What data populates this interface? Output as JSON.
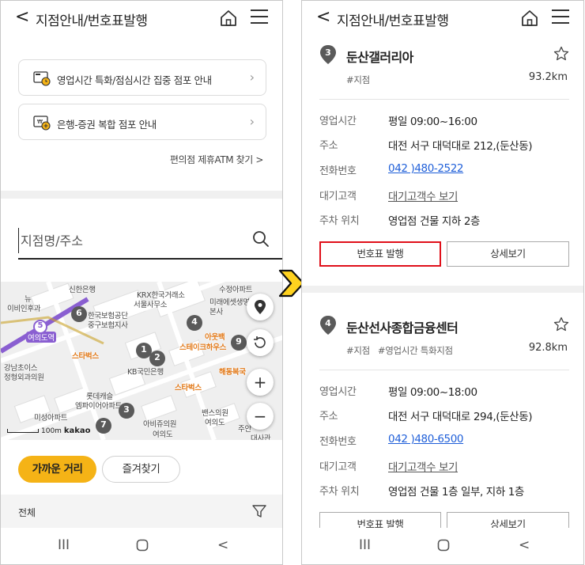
{
  "left": {
    "header": {
      "back_label": "<",
      "title": "지점안내/번호표발행"
    },
    "links": [
      {
        "label": "영업시간 특화/점심시간 집중 점포 안내",
        "icon": "clock-card-icon"
      },
      {
        "label": "은행-증권 복합 점포 안내",
        "icon": "won-card-icon"
      }
    ],
    "atm_link": "편의점 제휴ATM 찾기 >",
    "search": {
      "placeholder": "지점명/주소",
      "value": ""
    },
    "map": {
      "labels": [
        "신한은행",
        "KRX한국거래소",
        "서울사무소",
        "수정아파트",
        "미래에셋생명",
        "본사",
        "뉴",
        "이비인후과",
        "한국보험공단",
        "중구보험지사",
        "여의도역",
        "스타벅스",
        "KB국민은행",
        "아웃백",
        "스테이크하우스",
        "해동복국",
        "강남초이스",
        "정형외과의원",
        "스타벅스",
        "롯데캐슬",
        "엠파이어아파트",
        "미성아파트",
        "아비쥬의원",
        "여의도",
        "밴스의원",
        "여의도",
        "주안",
        "대사관",
        "100m",
        "kakao"
      ],
      "pins": [
        "6",
        "1",
        "2",
        "4",
        "9",
        "3",
        "7",
        "5"
      ],
      "scale": "100m",
      "brand": "kakao"
    },
    "tabs": {
      "nearby": "가까운 거리",
      "favorites": "즐겨찾기"
    },
    "filter": {
      "label": "전체"
    },
    "nav": {
      "recent": "III",
      "home": "○",
      "back": "<"
    }
  },
  "right": {
    "header": {
      "back_label": "<",
      "title": "지점안내/번호표발행"
    },
    "branches": [
      {
        "number": "3",
        "name": "둔산갤러리아",
        "tags": [
          "#지점"
        ],
        "distance": "93.2km",
        "rows": [
          {
            "key": "영업시간",
            "value": "평일 09:00~16:00"
          },
          {
            "key": "주소",
            "value": "대전 서구 대덕대로 212,(둔산동)"
          },
          {
            "key": "전화번호",
            "value": "042 )480-2522"
          },
          {
            "key": "대기고객",
            "value": "대기고객수 보기"
          },
          {
            "key": "주차 위치",
            "value": "영업점 건물 지하 2층"
          }
        ],
        "issue_button": "번호표 발행",
        "detail_button": "상세보기"
      },
      {
        "number": "4",
        "name": "둔산선사종합금융센터",
        "tags": [
          "#지점",
          "#영업시간 특화지점"
        ],
        "distance": "92.8km",
        "rows": [
          {
            "key": "영업시간",
            "value": "평일 09:00~18:00"
          },
          {
            "key": "주소",
            "value": "대전 서구 대덕대로 294,(둔산동)"
          },
          {
            "key": "전화번호",
            "value": "042 )480-6500"
          },
          {
            "key": "대기고객",
            "value": "대기고객수 보기"
          },
          {
            "key": "주차 위치",
            "value": "영업점 건물 1층 일부, 지하 1층"
          }
        ],
        "issue_button": "번호표 발행",
        "detail_button": "상세보기"
      }
    ],
    "nav": {
      "recent": "III",
      "home": "○",
      "back": "<"
    }
  },
  "colors": {
    "accent": "#f5b316",
    "highlight": "#e0101a",
    "link": "#1f5fd9",
    "pin": "#5a5a5a"
  }
}
